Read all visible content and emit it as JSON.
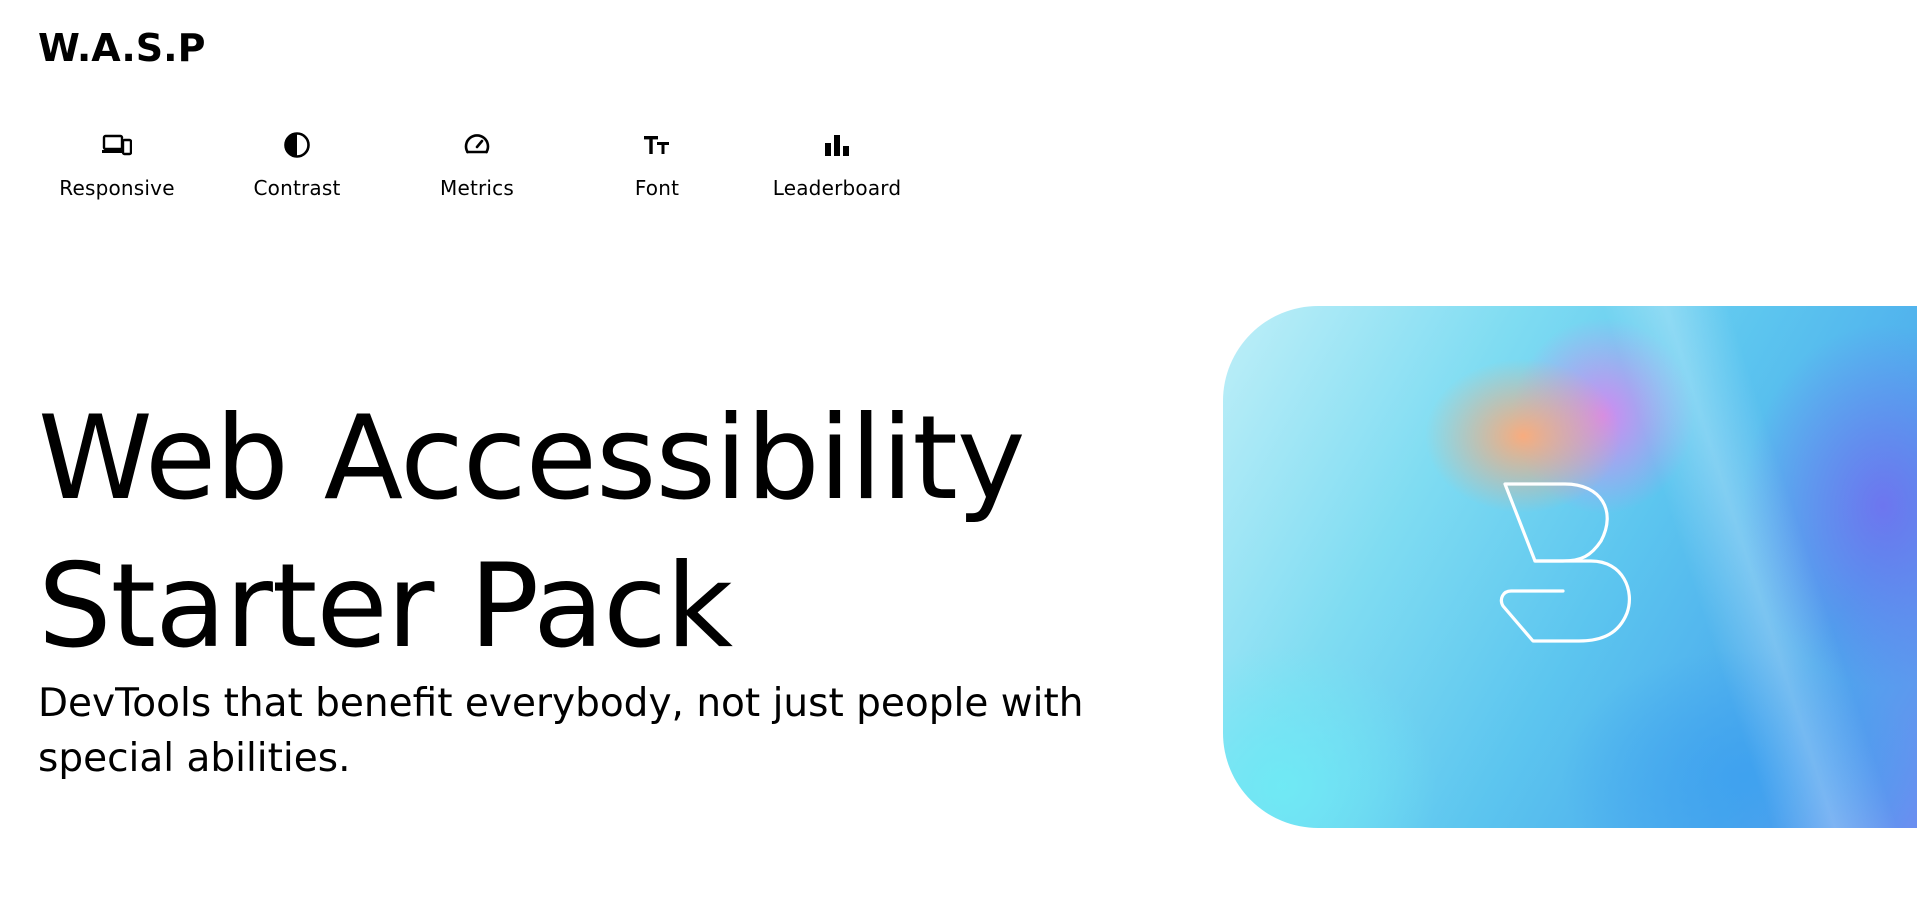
{
  "brand": {
    "name": "W.A.S.P"
  },
  "nav": {
    "items": [
      {
        "label": "Responsive",
        "icon": "devices-icon"
      },
      {
        "label": "Contrast",
        "icon": "contrast-icon"
      },
      {
        "label": "Metrics",
        "icon": "speedometer-icon"
      },
      {
        "label": "Font",
        "icon": "text-size-icon"
      },
      {
        "label": "Leaderboard",
        "icon": "bar-chart-icon"
      }
    ]
  },
  "hero": {
    "title_line1": "Web Accessibility",
    "title_line2": "Starter Pack",
    "subtitle": "DevTools that benefit everybody, not just people with special abilities.",
    "image_icon": "logo-mark-icon"
  },
  "colors": {
    "text": "#000000",
    "background": "#ffffff",
    "card_gradient_start": "#bfeff8",
    "card_gradient_end": "#6a8ef0"
  }
}
